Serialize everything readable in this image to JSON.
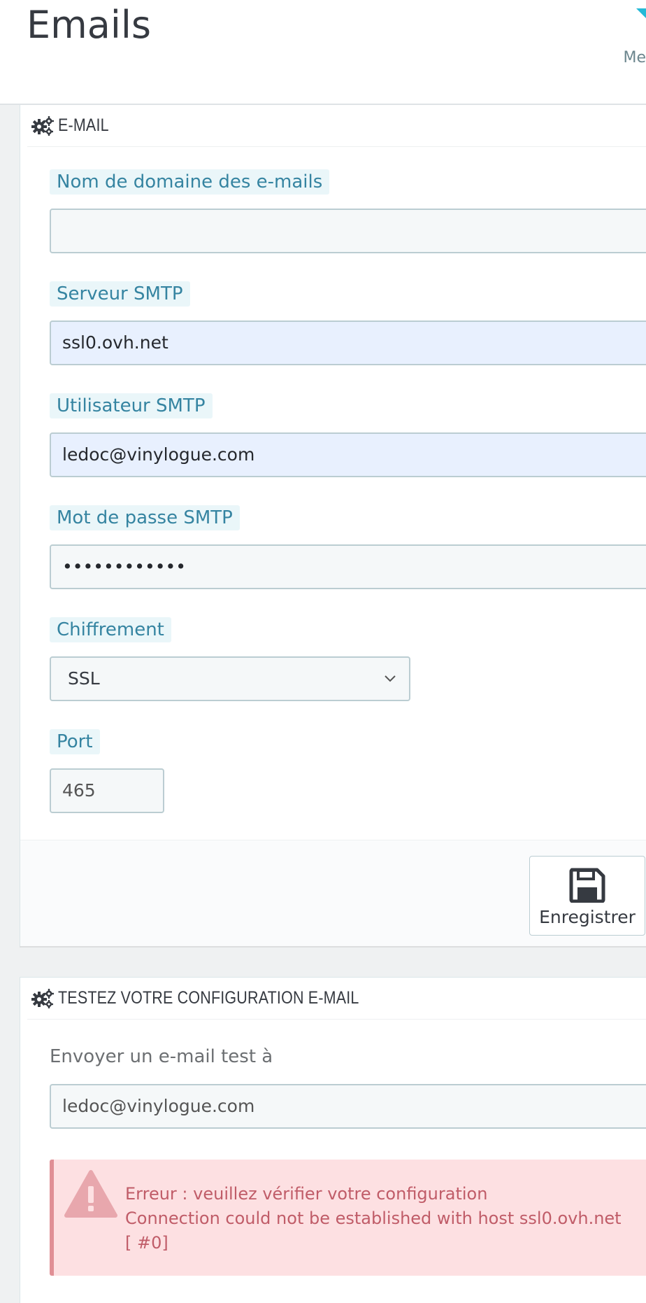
{
  "header": {
    "title": "Emails",
    "link_text": "Me"
  },
  "email_panel": {
    "heading": "E-MAIL",
    "fields": {
      "domain": {
        "label": "Nom de domaine des e-mails",
        "value": ""
      },
      "smtp_server": {
        "label": "Serveur SMTP",
        "value": "ssl0.ovh.net"
      },
      "smtp_user": {
        "label": "Utilisateur SMTP",
        "value": "ledoc@vinylogue.com"
      },
      "smtp_password": {
        "label": "Mot de passe SMTP",
        "value": "••••••••••••"
      },
      "encryption": {
        "label": "Chiffrement",
        "value": "SSL"
      },
      "port": {
        "label": "Port",
        "value": "465"
      }
    },
    "save_label": "Enregistrer"
  },
  "test_panel": {
    "heading": "TESTEZ VOTRE CONFIGURATION E-MAIL",
    "send_label": "Envoyer un e-mail test à",
    "send_value": "ledoc@vinylogue.com",
    "error": {
      "line1": "Erreur : veuillez vérifier votre configuration",
      "line2": "Connection could not be established with host ssl0.ovh.net",
      "line3": "[ #0]"
    }
  },
  "icons": {
    "heading_icon": "cogs-icon",
    "save_icon": "floppy-disk-icon",
    "alert_icon": "warning-triangle-icon",
    "select_icon": "chevron-down-icon"
  },
  "colors": {
    "accent": "#25b9d7",
    "label_text": "#3584a1",
    "label_bg": "#eaf6f9",
    "error_bg": "#fde0e2",
    "error_text": "#c05c68"
  }
}
